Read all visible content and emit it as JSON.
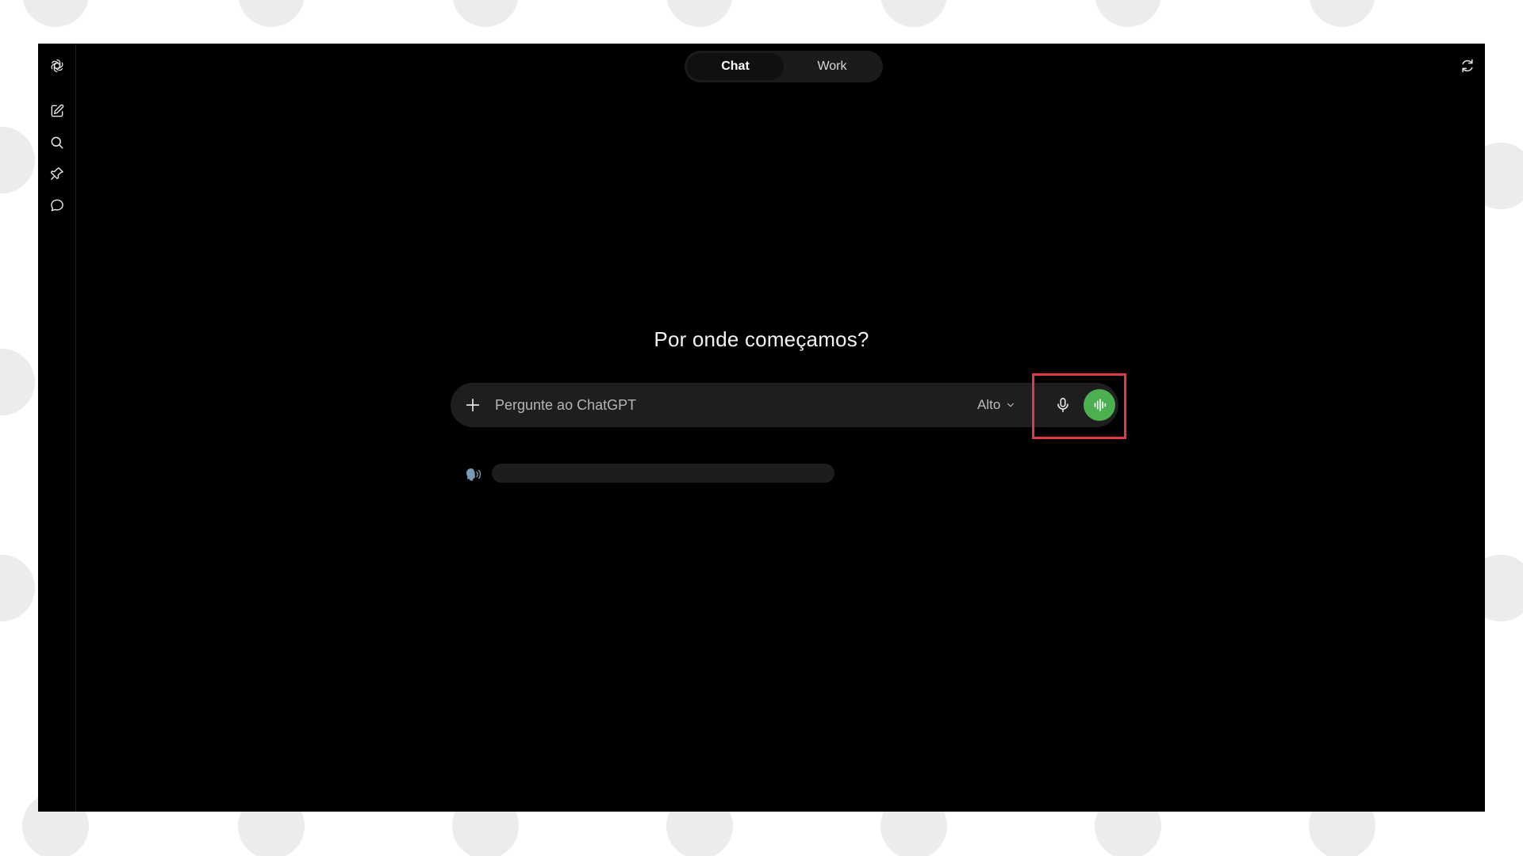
{
  "colors": {
    "accent_green": "#4caf50",
    "highlight_red": "#e03a45",
    "app_background": "#000000",
    "composer_background": "#1e1e1e"
  },
  "sidebar": {
    "items": [
      {
        "icon": "openai-logo-icon"
      },
      {
        "icon": "new-chat-icon"
      },
      {
        "icon": "search-icon"
      },
      {
        "icon": "pin-icon"
      },
      {
        "icon": "chat-bubble-icon"
      }
    ]
  },
  "mode_switch": {
    "tabs": [
      {
        "label": "Chat",
        "active": true
      },
      {
        "label": "Work",
        "active": false
      }
    ]
  },
  "header": {
    "right_icon": "refresh-icon"
  },
  "main": {
    "headline": "Por onde começamos?"
  },
  "composer": {
    "placeholder": "Pergunte ao ChatGPT",
    "value": "",
    "model_label": "Alto",
    "plus_icon": "plus-icon",
    "mic_icon": "microphone-icon",
    "voice_icon": "voice-waveform-icon"
  },
  "suggestion": {
    "icon": "speaking-head-icon",
    "text_redacted": true
  }
}
